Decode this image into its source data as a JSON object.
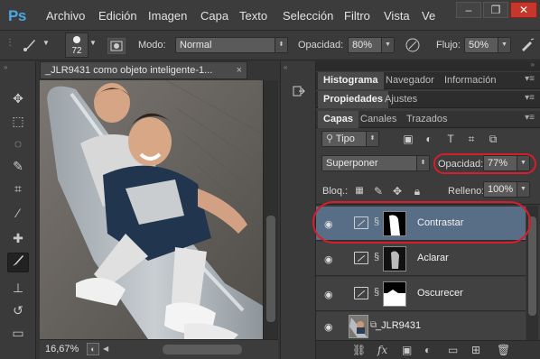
{
  "app": {
    "logo": "Ps"
  },
  "menu": [
    "Archivo",
    "Edición",
    "Imagen",
    "Capa",
    "Texto",
    "Selección",
    "Filtro",
    "Vista",
    "Ve"
  ],
  "window_controls": {
    "minimize": "–",
    "restore": "❐",
    "close": "✕"
  },
  "options_bar": {
    "brush_size": "72",
    "mode_label": "Modo:",
    "mode_value": "Normal",
    "opacity_label": "Opacidad:",
    "opacity_value": "80%",
    "flow_label": "Flujo:",
    "flow_value": "50%"
  },
  "document": {
    "tab_title": "_JLR9431 como objeto inteligente-1...",
    "tab_close": "×",
    "zoom": "16,67%"
  },
  "panels": {
    "row1_tabs": [
      "Histograma",
      "Navegador",
      "Información"
    ],
    "row2_tabs": [
      "Propiedades",
      "Ajustes"
    ],
    "row3_tabs": [
      "Capas",
      "Canales",
      "Trazados"
    ],
    "filter_kind": "Tipo",
    "blend_mode": "Superponer",
    "opacity_label": "Opacidad:",
    "opacity_value": "77%",
    "lock_label": "Bloq.:",
    "fill_label": "Relleno:",
    "fill_value": "100%",
    "layers": [
      {
        "name": "Contrastar",
        "selected": true
      },
      {
        "name": "Aclarar",
        "selected": false
      },
      {
        "name": "Oscurecer",
        "selected": false
      },
      {
        "name": "_JLR9431",
        "selected": false
      }
    ]
  },
  "colors": {
    "accent": "#4aa7e6",
    "highlight": "#d71d2a",
    "selected_layer": "#586e86"
  }
}
